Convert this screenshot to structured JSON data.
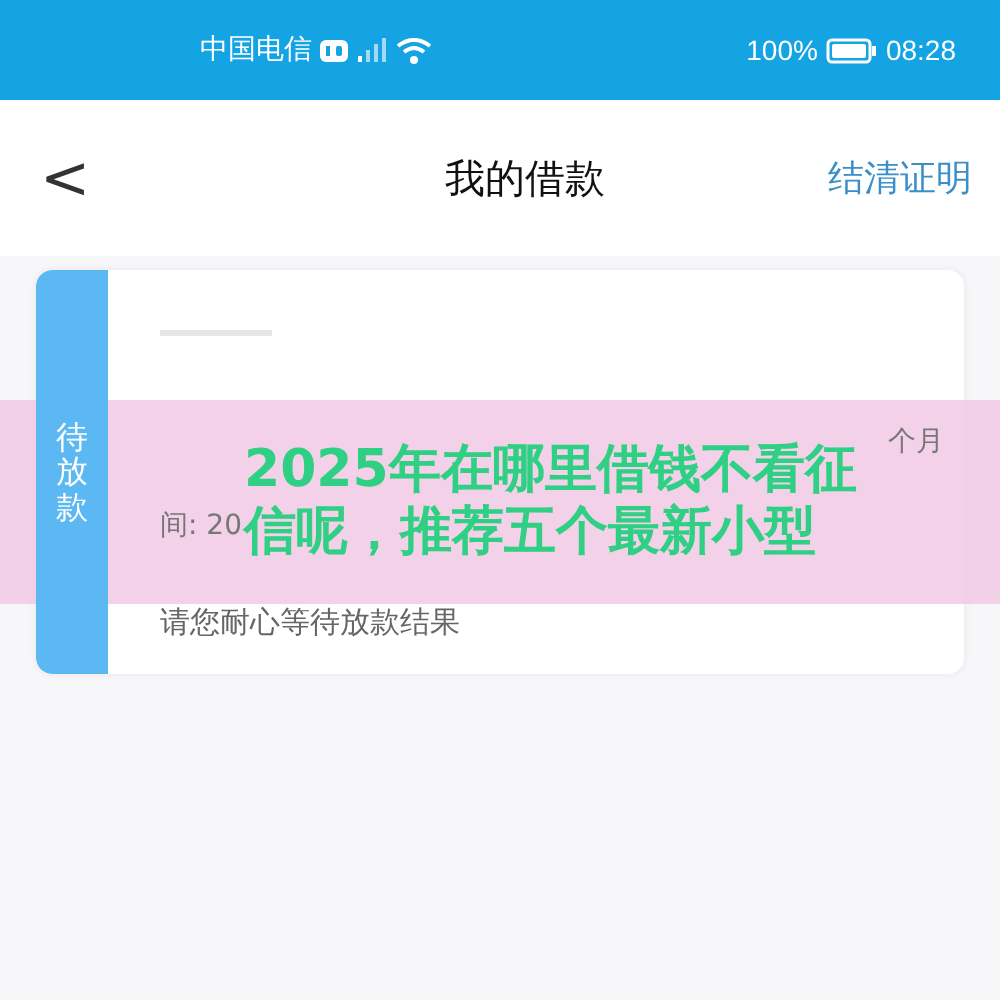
{
  "status_bar": {
    "carrier": "中国电信",
    "battery_text": "100%",
    "time": "08:28"
  },
  "nav": {
    "back": "<",
    "title": "我的借款",
    "action": "结清证明"
  },
  "loan_card": {
    "status_tab": "待放款",
    "detail_right": "个月",
    "detail_left": "间: 20",
    "note": "请您耐心等待放款结果"
  },
  "overlay_banner": {
    "title": "2025年在哪里借钱不看征信呢，推荐五个最新小型"
  }
}
